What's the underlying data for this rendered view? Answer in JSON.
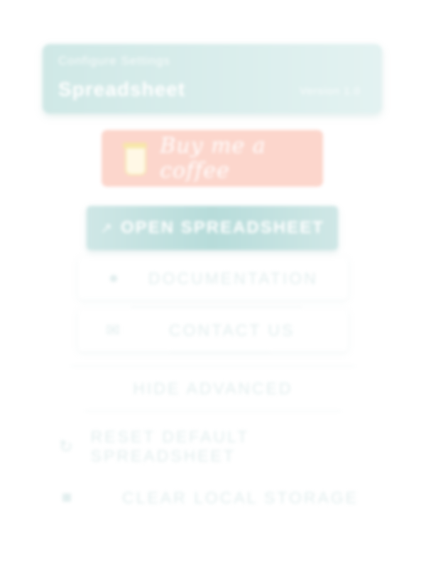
{
  "header": {
    "subtitle": "Configure Settings",
    "title": "Spreadsheet",
    "right_text": "Version 1.0"
  },
  "coffee": {
    "label": "Buy me a coffee"
  },
  "actions": {
    "open_spreadsheet": "OPEN SPREADSHEET",
    "documentation": "DOCUMENTATION",
    "contact_us": "CONTACT US",
    "hide_advanced": "HIDE ADVANCED",
    "reset_default": "RESET DEFAULT SPREADSHEET",
    "clear_local": "CLEAR LOCAL STORAGE"
  },
  "icons": {
    "open": "external-link-icon",
    "documentation": "info-circle-icon",
    "contact": "envelope-icon",
    "reset": "refresh-icon",
    "clear": "trash-icon"
  },
  "colors": {
    "accent": "#b7dcda",
    "coffee_bg": "#fcd6cc",
    "muted_text": "#e2eeee"
  }
}
